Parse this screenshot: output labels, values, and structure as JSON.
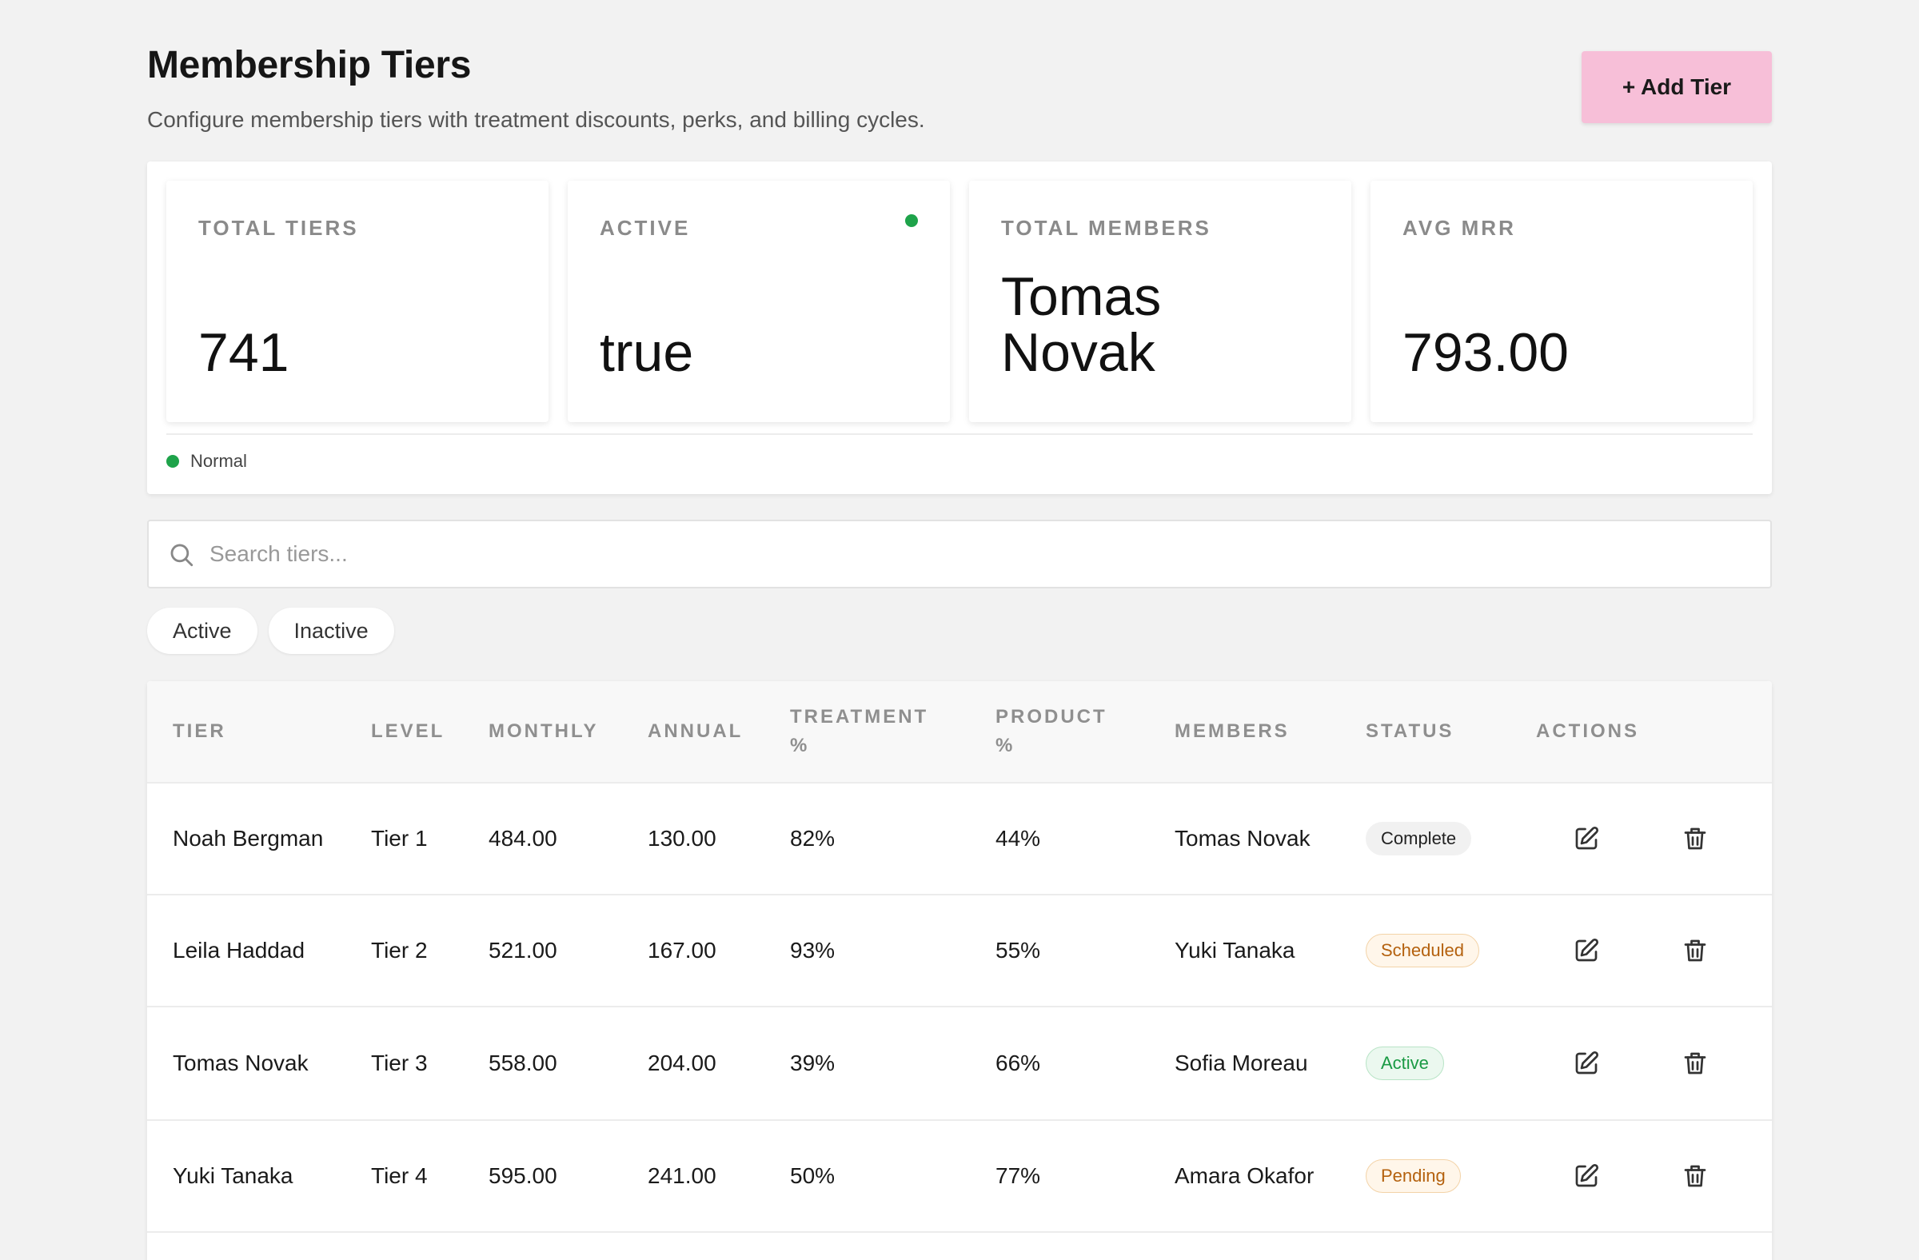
{
  "header": {
    "title": "Membership Tiers",
    "subtitle": "Configure membership tiers with treatment discounts, perks, and billing cycles.",
    "add_button_label": "+ Add Tier"
  },
  "stats": {
    "total_tiers": {
      "label": "TOTAL TIERS",
      "value": "741"
    },
    "active": {
      "label": "ACTIVE",
      "value": "true"
    },
    "total_members": {
      "label": "TOTAL MEMBERS",
      "value": "Tomas Novak"
    },
    "avg_mrr": {
      "label": "AVG MRR",
      "value": "793.00"
    },
    "status_text": "Normal"
  },
  "search": {
    "placeholder": "Search tiers...",
    "value": ""
  },
  "filters": [
    "Active",
    "Inactive"
  ],
  "table": {
    "columns": [
      "TIER",
      "LEVEL",
      "MONTHLY",
      "ANNUAL",
      "TREATMENT %",
      "PRODUCT %",
      "MEMBERS",
      "STATUS",
      "ACTIONS"
    ],
    "rows": [
      {
        "tier": "Noah Bergman",
        "level": "Tier 1",
        "monthly": "484.00",
        "annual": "130.00",
        "treatment": "82%",
        "product": "44%",
        "members": "Tomas Novak",
        "status": "Complete"
      },
      {
        "tier": "Leila Haddad",
        "level": "Tier 2",
        "monthly": "521.00",
        "annual": "167.00",
        "treatment": "93%",
        "product": "55%",
        "members": "Yuki Tanaka",
        "status": "Scheduled"
      },
      {
        "tier": "Tomas Novak",
        "level": "Tier 3",
        "monthly": "558.00",
        "annual": "204.00",
        "treatment": "39%",
        "product": "66%",
        "members": "Sofia Moreau",
        "status": "Active"
      },
      {
        "tier": "Yuki Tanaka",
        "level": "Tier 4",
        "monthly": "595.00",
        "annual": "241.00",
        "treatment": "50%",
        "product": "77%",
        "members": "Amara Okafor",
        "status": "Pending"
      }
    ]
  },
  "colors": {
    "accent_button": "#f7bfd8",
    "status_green": "#1ea34a",
    "badge_warning": "#b4610e",
    "badge_active": "#1a9a44"
  },
  "icons": {
    "search": "search-icon",
    "edit": "edit-icon",
    "delete": "trash-icon"
  }
}
